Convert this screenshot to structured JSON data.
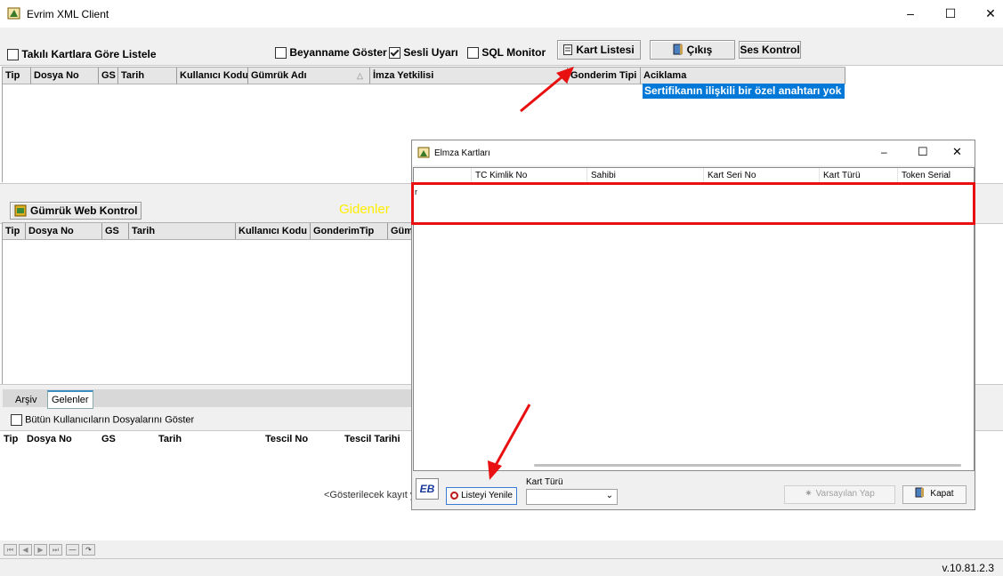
{
  "window": {
    "title": "Evrim XML Client",
    "version": "v.10.81.2.3"
  },
  "toolbar": {
    "takili_kart_label": "Takılı Kartlara Göre Listele",
    "beyanname_label": "Beyanname Göster",
    "sesli_label": "Sesli Uyarı",
    "sql_label": "SQL Monitor",
    "kart_listesi_label": "Kart Listesi",
    "cikis_label": "Çıkış",
    "ses_kontrol_label": "Ses Kontrol"
  },
  "grid1": {
    "columns": [
      "Tip",
      "Dosya No",
      "GS",
      "Tarih",
      "Kullanıcı Kodu",
      "Gümrük Adı",
      "İmza Yetkilisi",
      "Gonderim Tipi",
      "Aciklama"
    ],
    "aciklama_value": "Sertifikanın ilişkili bir özel anahtarı yok"
  },
  "section2": {
    "gumruk_web_label": "Gümrük Web Kontrol",
    "gidenler_label": "Gidenler",
    "columns": [
      "Tip",
      "Dosya No",
      "GS",
      "Tarih",
      "Kullanıcı Kodu",
      "GonderimTip",
      "Güm"
    ]
  },
  "section3": {
    "tabs": [
      "Arşiv",
      "Gelenler"
    ],
    "butun_label": "Bütün Kullanıcıların Dosyalarını Göster",
    "columns": [
      "Tip",
      "Dosya No",
      "GS",
      "Tarih",
      "Tescil No",
      "Tescil Tarihi"
    ],
    "empty_text": "<Gösterilecek kayıt y"
  },
  "dialog": {
    "title": "Elmza Kartları",
    "columns": [
      "TC Kimlik No",
      "Sahibi",
      "Kart Seri No",
      "Kart Türü",
      "Token Serial"
    ],
    "row_text": "r",
    "refresh_label": "Listeyi Yenile",
    "kart_turu_label": "Kart Türü",
    "varsayilan_label": "Varsayılan Yap",
    "kapat_label": "Kapat",
    "logo_text": "EB"
  },
  "colors": {
    "selection": "#0078d7",
    "annotation_red": "#e81010",
    "gidenler_yellow": "#ffee00"
  }
}
